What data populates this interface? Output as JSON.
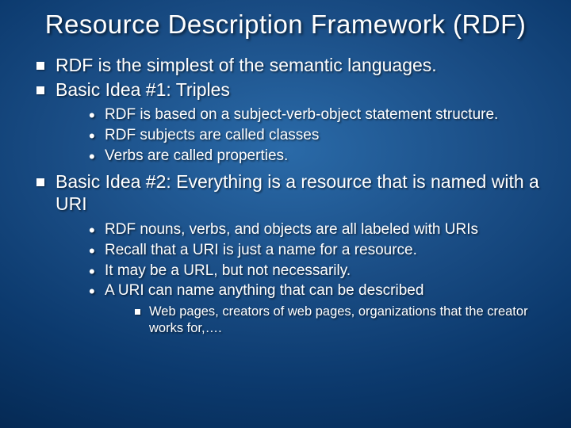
{
  "title": "Resource Description Framework (RDF)",
  "bullets": {
    "b1": "RDF is the simplest of the semantic languages.",
    "b2": "Basic Idea #1: Triples",
    "b2_sub": {
      "s1": "RDF is based on a subject-verb-object statement structure.",
      "s2": "RDF subjects are called classes",
      "s3": "Verbs are called properties."
    },
    "b3": "Basic Idea #2: Everything is a resource that is named with a URI",
    "b3_sub": {
      "s1": "RDF nouns, verbs, and objects are all labeled with URIs",
      "s2": "Recall that a URI is just a name for a resource.",
      "s3": "It may be a URL, but not necessarily.",
      "s4": "A URI can name anything that can be described",
      "s4_sub": {
        "t1": "Web pages, creators of web pages, organizations that the creator works for,…."
      }
    }
  }
}
